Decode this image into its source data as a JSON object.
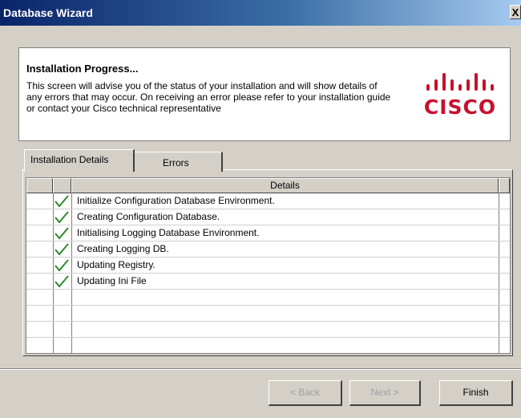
{
  "window": {
    "title": "Database Wizard",
    "close_glyph": "X"
  },
  "header": {
    "title": "Installation Progress...",
    "description": "This screen will advise you of the status of your installation and will show details of any errors that may occur. On receiving an error please refer to your installation guide or contact your Cisco technical representative",
    "logo_text": "CISCO",
    "logo_color": "#c8102e"
  },
  "tabs": [
    {
      "label": "Installation Details",
      "active": true
    },
    {
      "label": "Errors",
      "active": false
    }
  ],
  "grid": {
    "column_header": "Details",
    "check_color": "#2a8a2a",
    "rows": [
      {
        "status": "check-icon",
        "text": "Initialize Configuration Database Environment."
      },
      {
        "status": "check-icon",
        "text": "Creating Configuration Database."
      },
      {
        "status": "check-icon",
        "text": "Initialising Logging Database Environment."
      },
      {
        "status": "check-icon",
        "text": "Creating Logging DB."
      },
      {
        "status": "check-icon",
        "text": "Updating Registry."
      },
      {
        "status": "check-icon",
        "text": "Updating Ini File"
      },
      {
        "status": "",
        "text": ""
      },
      {
        "status": "",
        "text": ""
      },
      {
        "status": "",
        "text": ""
      },
      {
        "status": "",
        "text": ""
      }
    ]
  },
  "buttons": {
    "back": {
      "label": "< Back",
      "enabled": false
    },
    "next": {
      "label": "Next >",
      "enabled": false
    },
    "finish": {
      "label": "Finish",
      "enabled": true
    }
  }
}
